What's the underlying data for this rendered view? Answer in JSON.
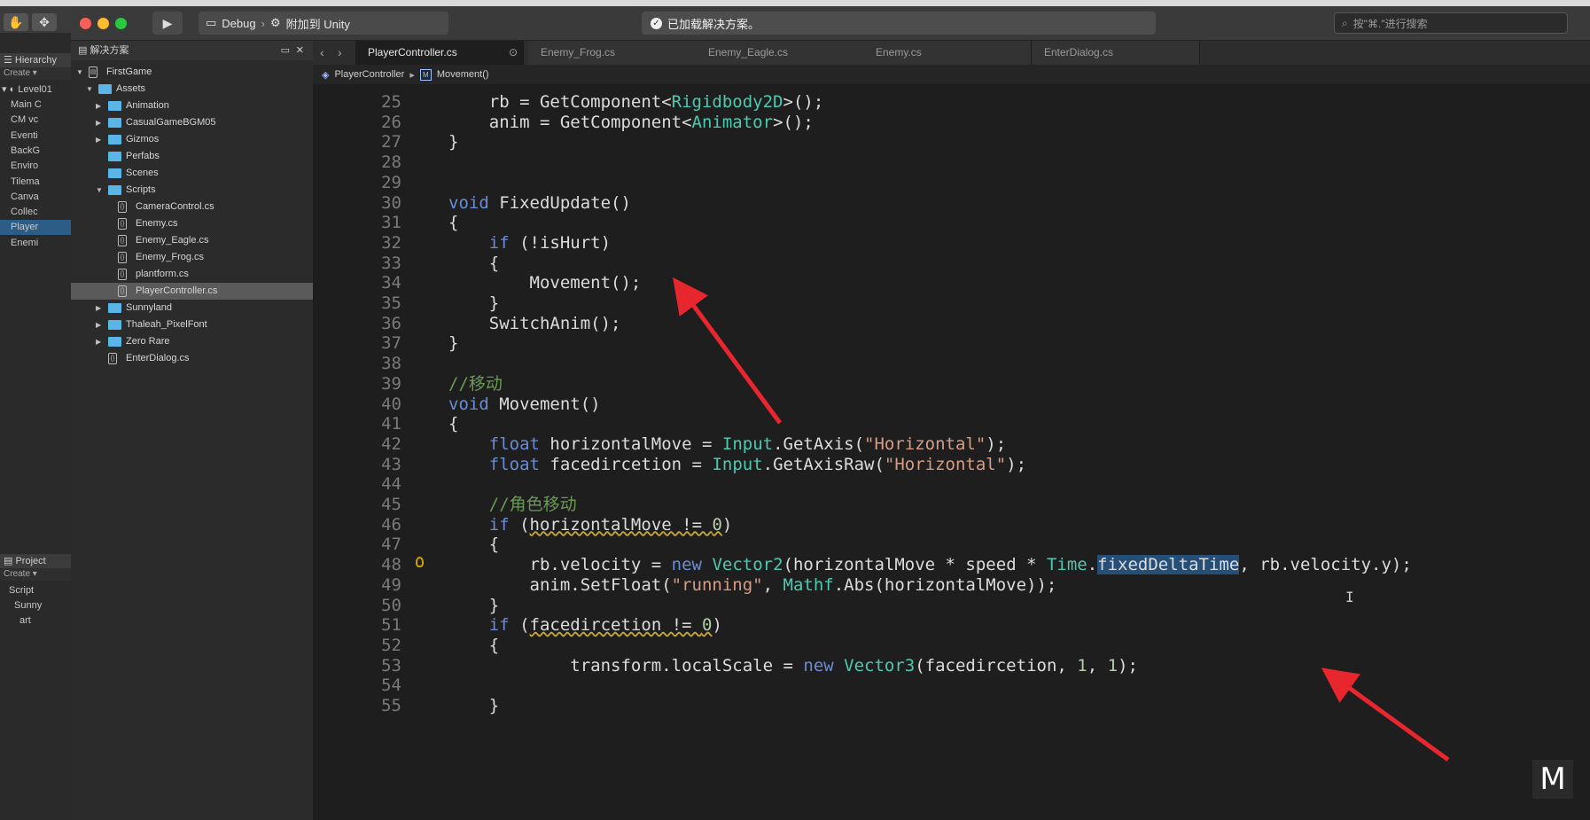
{
  "colors": {
    "accent_blue": "#5bb6e8",
    "selection": "#264f78",
    "arrow_red": "#e8262e"
  },
  "vs": {
    "run_icon": "play-icon",
    "config": "Debug",
    "attach": "附加到 Unity",
    "status": "已加载解决方案。",
    "search_placeholder": "按\"⌘.\"进行搜索"
  },
  "unity": {
    "hierarchy_title": "Hierarchy",
    "create": "Create ▾",
    "scene": "Level01",
    "rows": [
      "Main C",
      "CM vc",
      "Eventi",
      "BackG",
      "Enviro",
      "Tilema",
      "Canva",
      "Collec",
      "Player",
      "Enemi"
    ],
    "project_title": "Project",
    "project_rows": [
      "Script",
      "Sunny",
      "art"
    ]
  },
  "solution": {
    "title": "解决方案",
    "items": [
      {
        "label": "FirstGame",
        "depth": 0,
        "kind": "project",
        "open": true
      },
      {
        "label": "Assets",
        "depth": 1,
        "kind": "folder",
        "open": true
      },
      {
        "label": "Animation",
        "depth": 2,
        "kind": "folder",
        "open": false
      },
      {
        "label": "CasualGameBGM05",
        "depth": 2,
        "kind": "folder",
        "open": false
      },
      {
        "label": "Gizmos",
        "depth": 2,
        "kind": "folder",
        "open": false
      },
      {
        "label": "Perfabs",
        "depth": 2,
        "kind": "folder",
        "leaf": true
      },
      {
        "label": "Scenes",
        "depth": 2,
        "kind": "folder",
        "leaf": true
      },
      {
        "label": "Scripts",
        "depth": 2,
        "kind": "folder",
        "open": true
      },
      {
        "label": "CameraControl.cs",
        "depth": 3,
        "kind": "file"
      },
      {
        "label": "Enemy.cs",
        "depth": 3,
        "kind": "file"
      },
      {
        "label": "Enemy_Eagle.cs",
        "depth": 3,
        "kind": "file"
      },
      {
        "label": "Enemy_Frog.cs",
        "depth": 3,
        "kind": "file"
      },
      {
        "label": "plantform.cs",
        "depth": 3,
        "kind": "file"
      },
      {
        "label": "PlayerController.cs",
        "depth": 3,
        "kind": "file",
        "selected": true
      },
      {
        "label": "Sunnyland",
        "depth": 2,
        "kind": "folder",
        "open": false
      },
      {
        "label": "Thaleah_PixelFont",
        "depth": 2,
        "kind": "folder",
        "open": false
      },
      {
        "label": "Zero Rare",
        "depth": 2,
        "kind": "folder",
        "open": false
      },
      {
        "label": "EnterDialog.cs",
        "depth": 2,
        "kind": "file",
        "noarrow": true
      }
    ]
  },
  "tabs": [
    {
      "label": "PlayerController.cs",
      "active": true
    },
    {
      "label": "Enemy_Frog.cs"
    },
    {
      "label": "Enemy_Eagle.cs"
    },
    {
      "label": "Enemy.cs"
    },
    {
      "label": "EnterDialog.cs"
    }
  ],
  "breadcrumb": {
    "class": "PlayerController",
    "method": "Movement()"
  },
  "code_lines": [
    {
      "n": "25",
      "t": "    rb = GetComponent<Rigidbody2D>();"
    },
    {
      "n": "26",
      "t": "    anim = GetComponent<Animator>();"
    },
    {
      "n": "27",
      "t": "}"
    },
    {
      "n": "28",
      "t": ""
    },
    {
      "n": "29",
      "t": ""
    },
    {
      "n": "30",
      "t": "void FixedUpdate()"
    },
    {
      "n": "31",
      "t": "{"
    },
    {
      "n": "32",
      "t": "    if (!isHurt)"
    },
    {
      "n": "33",
      "t": "    {"
    },
    {
      "n": "34",
      "t": "        Movement();"
    },
    {
      "n": "35",
      "t": "    }"
    },
    {
      "n": "36",
      "t": "    SwitchAnim();"
    },
    {
      "n": "37",
      "t": "}"
    },
    {
      "n": "38",
      "t": ""
    },
    {
      "n": "39",
      "t": "//移动"
    },
    {
      "n": "40",
      "t": "void Movement()"
    },
    {
      "n": "41",
      "t": "{"
    },
    {
      "n": "42",
      "t": "    float horizontalMove = Input.GetAxis(\"Horizontal\");"
    },
    {
      "n": "43",
      "t": "    float facedircetion = Input.GetAxisRaw(\"Horizontal\");"
    },
    {
      "n": "44",
      "t": ""
    },
    {
      "n": "45",
      "t": "    //角色移动"
    },
    {
      "n": "46",
      "t": "    if (horizontalMove != 0)"
    },
    {
      "n": "47",
      "t": "    {"
    },
    {
      "n": "48",
      "t": "        rb.velocity = new Vector2(horizontalMove * speed * Time.fixedDeltaTime, rb.velocity.y);"
    },
    {
      "n": "49",
      "t": "        anim.SetFloat(\"running\", Mathf.Abs(horizontalMove));"
    },
    {
      "n": "50",
      "t": "    }"
    },
    {
      "n": "51",
      "t": "    if (facedircetion != 0)"
    },
    {
      "n": "52",
      "t": "    {"
    },
    {
      "n": "53",
      "t": "            transform.localScale = new Vector3(facedircetion, 1, 1);"
    },
    {
      "n": "54",
      "t": ""
    },
    {
      "n": "55",
      "t": "    }"
    }
  ],
  "logo_text": "M"
}
